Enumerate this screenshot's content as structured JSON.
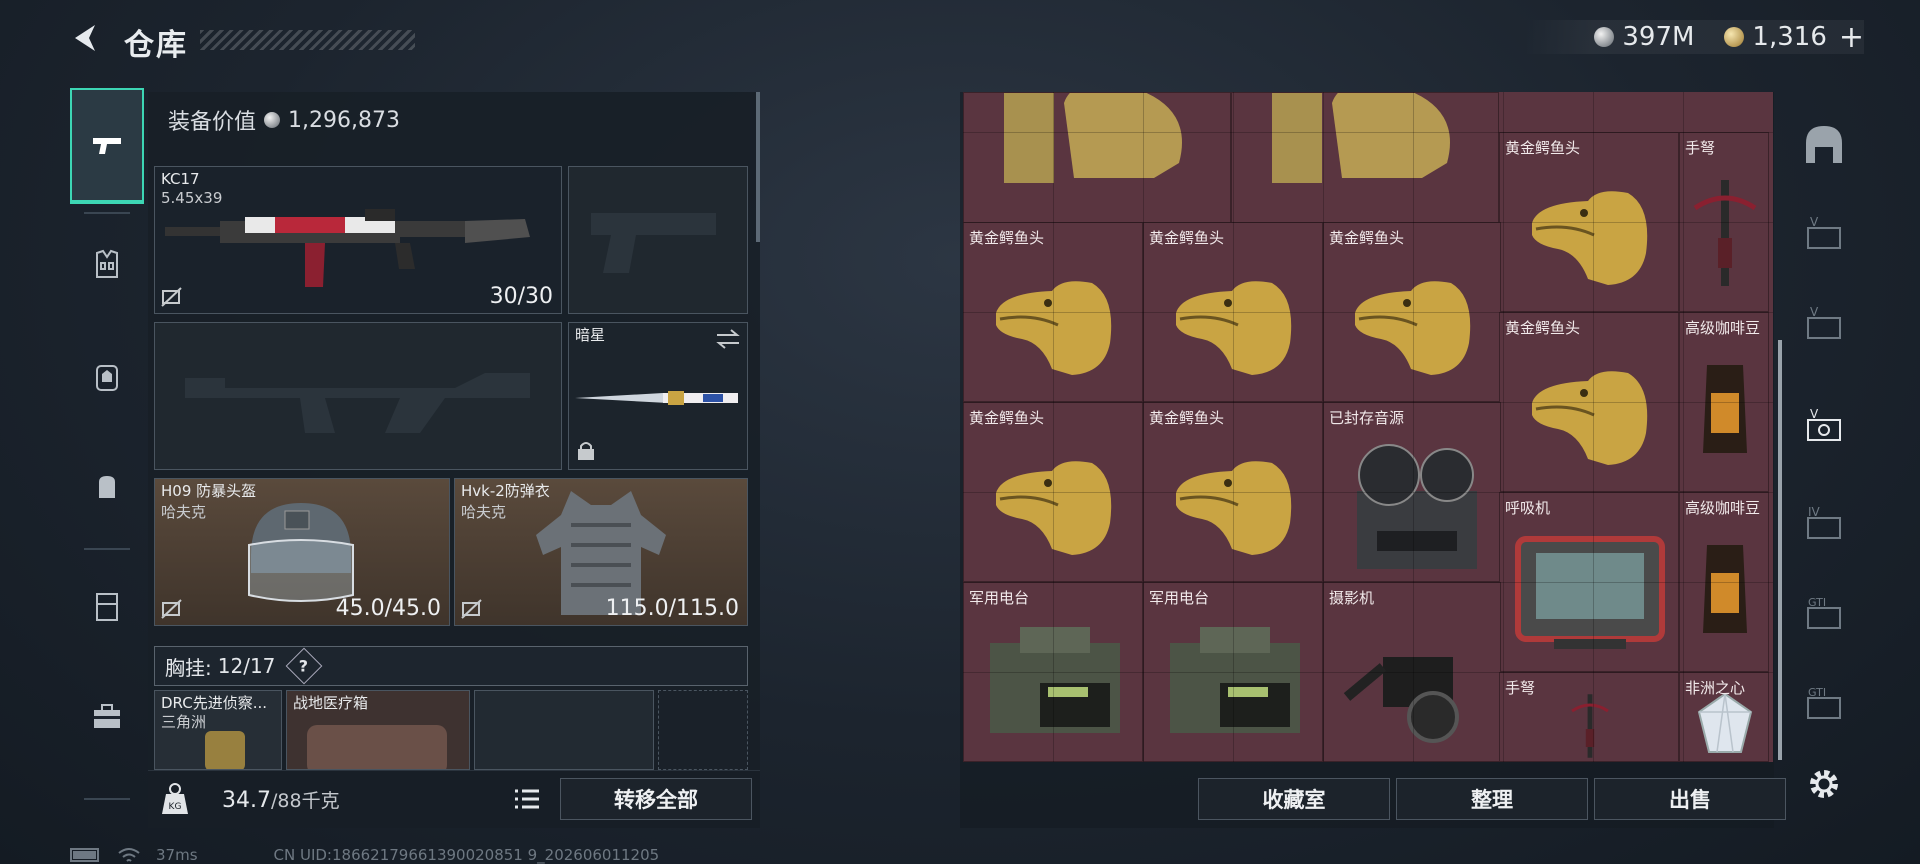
{
  "header": {
    "title": "仓库",
    "currency": [
      {
        "icon": "silver-coin-icon",
        "value": "397M"
      },
      {
        "icon": "gold-coin-icon",
        "value": "1,316"
      }
    ],
    "plus": "+"
  },
  "left_tabs": [
    "gun-icon",
    "vest-icon",
    "backpack-icon",
    "bag-icon",
    "locker-icon",
    "toolbox-icon"
  ],
  "equipment": {
    "value_label": "装备价值",
    "value": "1,296,873",
    "primary": {
      "name": "KC17",
      "caliber": "5.45x39",
      "ammo": "30/30"
    },
    "pistol": {
      "name": ""
    },
    "secondary": {
      "name": ""
    },
    "melee": {
      "name": "暗星"
    },
    "helmet": {
      "name": "H09 防暴头盔",
      "brand": "哈夫克",
      "durability": "45.0/45.0"
    },
    "armor": {
      "name": "Hvk-2防弹衣",
      "brand": "哈夫克",
      "durability": "115.0/115.0"
    },
    "vest": {
      "label": "胸挂:",
      "capacity": "12/17",
      "help": "?"
    },
    "vest_items": [
      {
        "name": "DRC先进侦察...",
        "brand": "三角洲"
      },
      {
        "name": "战地医疗箱"
      },
      {
        "name": ""
      }
    ]
  },
  "bottom": {
    "weight": "34.7",
    "weight_max": "/88千克",
    "transfer_all": "转移全部"
  },
  "status": {
    "ping": "37ms",
    "uid": "CN UID:18662179661390020851 9_202606011205"
  },
  "storage": {
    "items": [
      {
        "name": "",
        "kind": "bust"
      },
      {
        "name": "",
        "kind": "bust"
      },
      {
        "name": "黄金鳄鱼头",
        "kind": "croc"
      },
      {
        "name": "手弩",
        "kind": "crossbow"
      },
      {
        "name": "黄金鳄鱼头",
        "kind": "croc"
      },
      {
        "name": "黄金鳄鱼头",
        "kind": "croc"
      },
      {
        "name": "黄金鳄鱼头",
        "kind": "croc"
      },
      {
        "name": "黄金鳄鱼头",
        "kind": "croc"
      },
      {
        "name": "高级咖啡豆",
        "kind": "coffee"
      },
      {
        "name": "黄金鳄鱼头",
        "kind": "croc"
      },
      {
        "name": "黄金鳄鱼头",
        "kind": "croc"
      },
      {
        "name": "已封存音源",
        "kind": "recorder"
      },
      {
        "name": "呼吸机",
        "kind": "ventilator"
      },
      {
        "name": "高级咖啡豆",
        "kind": "coffee"
      },
      {
        "name": "军用电台",
        "kind": "radio"
      },
      {
        "name": "军用电台",
        "kind": "radio"
      },
      {
        "name": "摄影机",
        "kind": "camera"
      },
      {
        "name": "手弩",
        "kind": "crossbow"
      },
      {
        "name": "非洲之心",
        "kind": "diamond"
      }
    ],
    "buttons": {
      "collection": "收藏室",
      "organize": "整理",
      "sell": "出售"
    }
  },
  "right_tabs": [
    "base-icon",
    "storage-v-1-icon",
    "storage-v-2-icon",
    "storage-v-3-icon",
    "storage-iv-icon",
    "storage-gti-1-icon",
    "storage-gti-2-icon",
    "settings-icon"
  ],
  "colors": {
    "accent": "#3dd6b4",
    "grid_bg": "#5a3540",
    "gold": "#c9a443"
  }
}
